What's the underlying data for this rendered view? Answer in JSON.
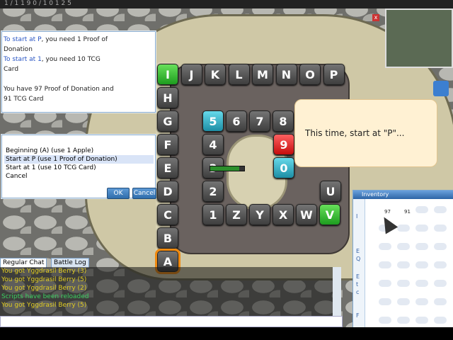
{
  "topbar": {
    "text": "1 / 1 1 9 0 / 1 0 1 2 5"
  },
  "dialog": {
    "lines": [
      {
        "text": "To start at P",
        "rest": ", you need 1 Proof of"
      },
      {
        "text": "",
        "rest": "Donation"
      },
      {
        "text": "To start at 1",
        "rest": ", you need 10 TCG"
      },
      {
        "text": "",
        "rest": "Card"
      },
      {
        "text": "",
        "rest": ""
      },
      {
        "text": "",
        "rest": "You have 97 Proof of Donation and"
      },
      {
        "text": "",
        "rest": "91 TCG Card"
      }
    ]
  },
  "menu": {
    "items": [
      "Beginning (A) (use 1 Apple)",
      "Start at P (use 1 Proof of Donation)",
      "Start at 1 (use 10 TCG Card)",
      "Cancel"
    ],
    "selected_index": 1,
    "ok_label": "OK",
    "cancel_label": "Cancel"
  },
  "board": {
    "top_row": [
      "I",
      "J",
      "K",
      "L",
      "M",
      "N",
      "O",
      "P"
    ],
    "left_column": [
      "H",
      "G",
      "F",
      "E",
      "D",
      "C",
      "B",
      "A"
    ],
    "inner_top": [
      "5",
      "6",
      "7",
      "8"
    ],
    "inner_left": [
      "4",
      "3",
      "2"
    ],
    "inner_mid": [
      "9",
      "0"
    ],
    "bottom_row": [
      "1",
      "Z",
      "Y",
      "X",
      "W",
      "V"
    ],
    "right_col": [
      "U"
    ],
    "colors": {
      "green": "#2fb02e",
      "cyan": "#31b6cf",
      "red": "#e02020",
      "orange": "#f08a10"
    }
  },
  "bubble": {
    "text": "This time, start at \"P\"..."
  },
  "inventory": {
    "title": "Inventory",
    "tabs": [
      "I",
      "E\nQ",
      "E\nt\nc",
      "F"
    ],
    "items": [
      {
        "count": "97"
      },
      {
        "count": "91"
      }
    ]
  },
  "chat": {
    "tabs": [
      "Regular Chat",
      "Battle Log"
    ],
    "lines": [
      {
        "text": "You got Yggdrasil Berry (3)",
        "kind": "item"
      },
      {
        "text": "You got Yggdrasil Berry (5)",
        "kind": "item"
      },
      {
        "text": "You got Yggdrasil Berry (2)",
        "kind": "item"
      },
      {
        "text": "Scripts have been reloaded",
        "kind": "sys"
      },
      {
        "text": "You got Yggdrasil Berry (5)",
        "kind": "item"
      }
    ]
  },
  "minimap": {
    "close_label": "x"
  }
}
